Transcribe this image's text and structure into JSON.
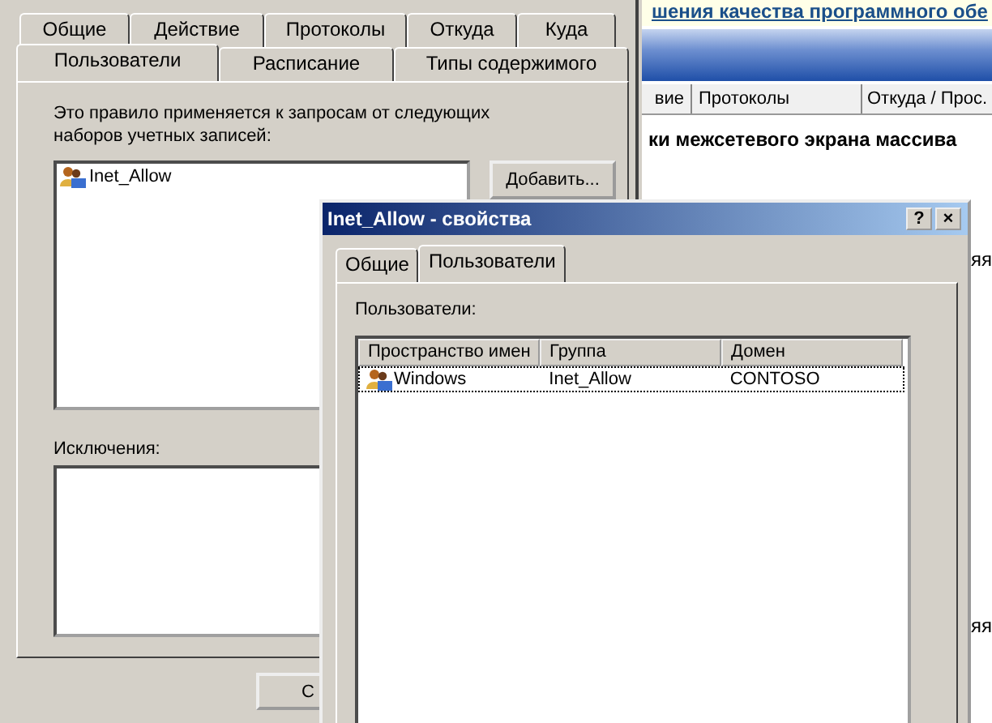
{
  "background_app": {
    "banner_link": "шения качества программного обе",
    "columns": [
      "вие",
      "Протоколы",
      "Откуда / Прос."
    ],
    "heading": "ки межсетевого экрана массива",
    "row_fragments": [
      "яя",
      "яя"
    ]
  },
  "rule_dialog": {
    "tabs_row_1": [
      {
        "label": "Общие",
        "selected": false
      },
      {
        "label": "Действие",
        "selected": false
      },
      {
        "label": "Протоколы",
        "selected": false
      },
      {
        "label": "Откуда",
        "selected": false
      },
      {
        "label": "Куда",
        "selected": false
      }
    ],
    "tabs_row_2": [
      {
        "label": "Пользователи",
        "selected": true
      },
      {
        "label": "Расписание",
        "selected": false
      },
      {
        "label": "Типы содержимого",
        "selected": false
      }
    ],
    "description": "Это правило применяется к запросам от следующих наборов учетных записей:",
    "accounts": [
      {
        "name": "Inet_Allow",
        "selected": false
      }
    ],
    "add_button": "Добавить...",
    "exceptions_label": "Исключения:",
    "bottom_button": "С"
  },
  "properties_dialog": {
    "title": "Inet_Allow - свойства",
    "title_buttons": [
      "?",
      "×"
    ],
    "tabs": [
      {
        "label": "Общие",
        "selected": false
      },
      {
        "label": "Пользователи",
        "selected": true
      }
    ],
    "users_label": "Пользователи:",
    "columns": [
      "Пространство имен",
      "Группа",
      "Домен"
    ],
    "rows": [
      {
        "namespace": "Windows",
        "group": "Inet_Allow",
        "domain": "CONTOSO",
        "selected": true
      }
    ]
  }
}
